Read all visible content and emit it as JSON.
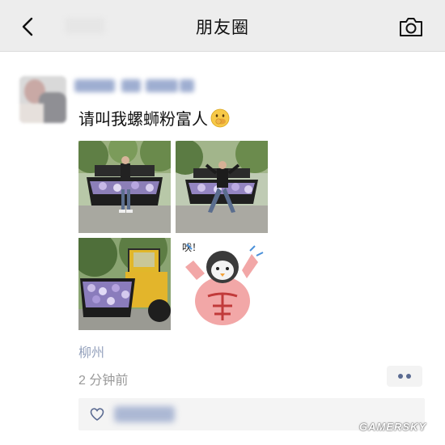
{
  "navbar": {
    "title": "朋友圈",
    "back_icon": "chevron-left-icon",
    "camera_icon": "camera-icon"
  },
  "post": {
    "text": "请叫我螺蛳粉富人",
    "emoji": "money-mouth-face-emoji",
    "photos": [
      {
        "description": "loader-bucket-with-snail-noodles-person-standing"
      },
      {
        "description": "loader-bucket-with-snail-noodles-person-posing"
      },
      {
        "description": "loader-full-of-snail-noodles"
      },
      {
        "description": "muscle-penguin-sticker",
        "sticker_text": "吠！"
      }
    ],
    "location": "柳州",
    "time": "2 分钟前",
    "more_icon": "more-dots-icon",
    "like_icon": "heart-icon"
  },
  "watermark": "GAMERSKY",
  "colors": {
    "navbar_bg": "#ededed",
    "link_blue": "#5b6b92",
    "location_blue": "#95a2bd",
    "time_gray": "#9a9a9a"
  }
}
